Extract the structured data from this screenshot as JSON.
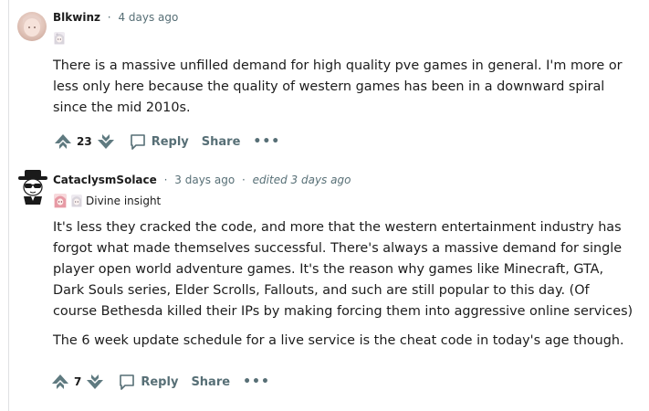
{
  "comments": [
    {
      "author": "Blkwinz",
      "time": "4 days ago",
      "edited": "",
      "flair_text": "",
      "paragraphs": [
        "There is a massive unfilled demand for high quality pve games in general. I'm more or less only here because the quality of western games has been in a downward spiral since the mid 2010s."
      ],
      "votes": "23",
      "reply_label": "Reply",
      "share_label": "Share",
      "more_label": "•••"
    },
    {
      "author": "CataclysmSolace",
      "time": "3 days ago",
      "edited": "edited 3 days ago",
      "flair_text": "Divine insight",
      "paragraphs": [
        "It's less they cracked the code, and more that the western entertainment industry has forgot what made themselves successful. There's always a massive demand for single player open world adventure games. It's the reason why games like Minecraft, GTA, Dark Souls series, Elder Scrolls, Fallouts, and such are still popular to this day. (Of course Bethesda killed their IPs by making forcing them into aggressive online services)",
        "The 6 week update schedule for a live service is the cheat code in today's age though."
      ],
      "votes": "7",
      "reply_label": "Reply",
      "share_label": "Share",
      "more_label": "•••"
    }
  ],
  "separator": "·",
  "icons": {
    "upvote": "upvote-icon",
    "downvote": "downvote-icon",
    "reply": "speech-bubble-icon",
    "flair_badge": "anime-girl-badge-icon"
  },
  "colors": {
    "meta_gray": "#576f76",
    "text": "#1c1c1c",
    "thread_line": "#dfe1e3"
  }
}
